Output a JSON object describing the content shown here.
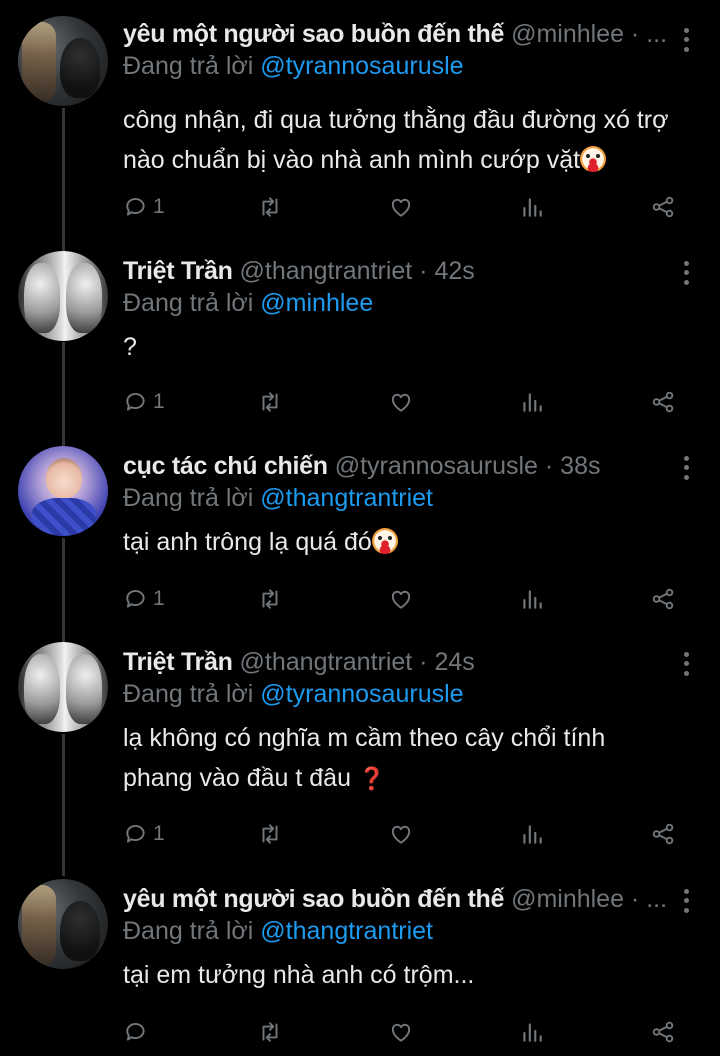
{
  "reply_prefix": "Đang trả lời",
  "tweets": [
    {
      "name": "yêu một người sao buồn đến thế",
      "meta": "@minhlee · ...",
      "reply_to": "@tyrannosaurusle",
      "text_line1": "công nhận, đi qua tưởng thằng đầu đường xó trợ",
      "text_line2": "nào chuẩn bị vào nhà anh mình cướp vặt",
      "reply_count": "1",
      "avatar_icon": "clown-emoji-appended"
    },
    {
      "name": "Triệt Trần",
      "meta": "@thangtrantriet · 42s",
      "reply_to": "@minhlee",
      "text_line1": "?",
      "reply_count": "1"
    },
    {
      "name": "cục tác chú chiến",
      "meta": "@tyrannosaurusle · 38s",
      "reply_to": "@thangtrantriet",
      "text_line1": "tại anh trông lạ quá đó",
      "reply_count": "1"
    },
    {
      "name": "Triệt Trần",
      "meta": "@thangtrantriet · 24s",
      "reply_to": "@tyrannosaurusle",
      "text_line1": "lạ không có nghĩa m cầm theo cây chổi tính",
      "text_line2": "phang vào đầu t đâu",
      "reply_count": "1"
    },
    {
      "name": "yêu một người sao buồn đến thế",
      "meta": "@minhlee · ...",
      "reply_to": "@thangtrantriet",
      "text_line1": "tại em tưởng nhà anh có trộm...",
      "reply_count": ""
    }
  ],
  "colors": {
    "background": "#000000",
    "primary_text": "#e7e9ea",
    "secondary_text": "#71767b",
    "link": "#1d9bf0",
    "thread_line": "#333639"
  },
  "icons": [
    "reply-icon",
    "retweet-icon",
    "like-icon",
    "stats-icon",
    "share-icon",
    "more-icon",
    "clown-emoji",
    "red-question-emoji"
  ]
}
